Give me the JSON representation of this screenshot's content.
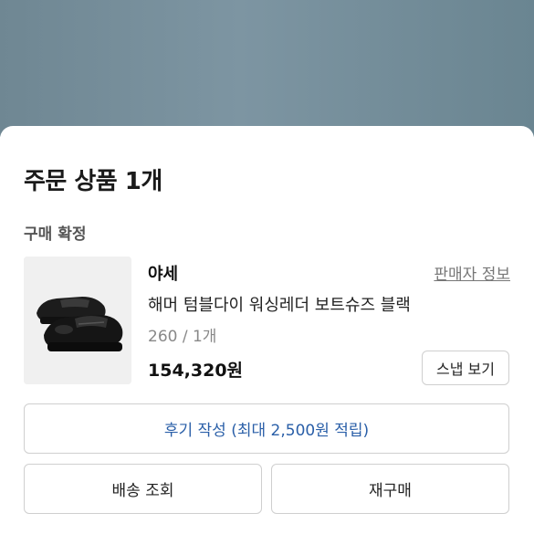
{
  "order": {
    "title": "주문 상품 1개",
    "status": "구매 확정"
  },
  "item": {
    "seller": "야세",
    "seller_link": "판매자 정보",
    "name": "해머 텀블다이 워싱레더 보트슈즈 블랙",
    "option": "260 / 1개",
    "price": "154,320원",
    "snap_button": "스냅 보기",
    "image": "black-leather-loafers"
  },
  "actions": {
    "review": "후기 작성 (최대 2,500원 적립)",
    "shipping": "배송 조회",
    "rebuy": "재구매"
  },
  "colors": {
    "review_text": "#2a5fa8",
    "overlay": "#7890a0"
  }
}
